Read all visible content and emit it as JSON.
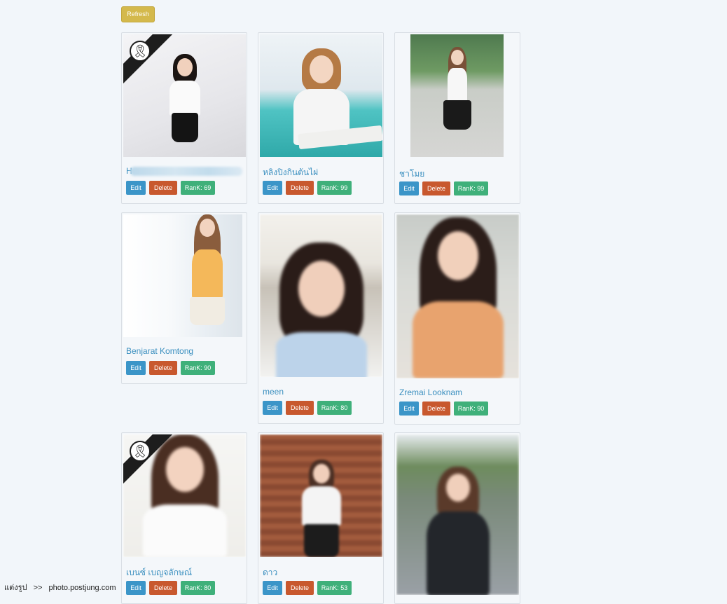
{
  "toolbar": {
    "refresh_label": "Refresh"
  },
  "cards": [
    {
      "name": "H",
      "edit": "Edit",
      "delete": "Delete",
      "rank": "RanK: 69"
    },
    {
      "name": "หลิงปิงกินต้นไผ่",
      "edit": "Edit",
      "delete": "Delete",
      "rank": "RanK: 99"
    },
    {
      "name": "ชาโมย",
      "edit": "Edit",
      "delete": "Delete",
      "rank": "RanK: 99"
    },
    {
      "name": "Benjarat Komtong",
      "edit": "Edit",
      "delete": "Delete",
      "rank": "RanK: 90"
    },
    {
      "name": "meen",
      "edit": "Edit",
      "delete": "Delete",
      "rank": "RanK: 80"
    },
    {
      "name": "Zremai Looknam",
      "edit": "Edit",
      "delete": "Delete",
      "rank": "RanK: 90"
    },
    {
      "name": "เบนซ์ เบญจลักษณ์",
      "edit": "Edit",
      "delete": "Delete",
      "rank": "RanK: 80"
    },
    {
      "name": "ดาว",
      "edit": "Edit",
      "delete": "Delete",
      "rank": "RanK: 53"
    },
    {
      "name": "",
      "edit": "",
      "delete": "",
      "rank": ""
    }
  ],
  "watermark": {
    "left": "แต่งรูป",
    "sep": ">>",
    "site": "photo.postjung.com"
  },
  "colors": {
    "edit": "#3b95c8",
    "delete": "#c8582e",
    "rank": "#3fb07a",
    "refresh": "#d4b94c",
    "link": "#3a8fbf"
  },
  "icons": {
    "mourning": "black-ribbon-icon"
  }
}
